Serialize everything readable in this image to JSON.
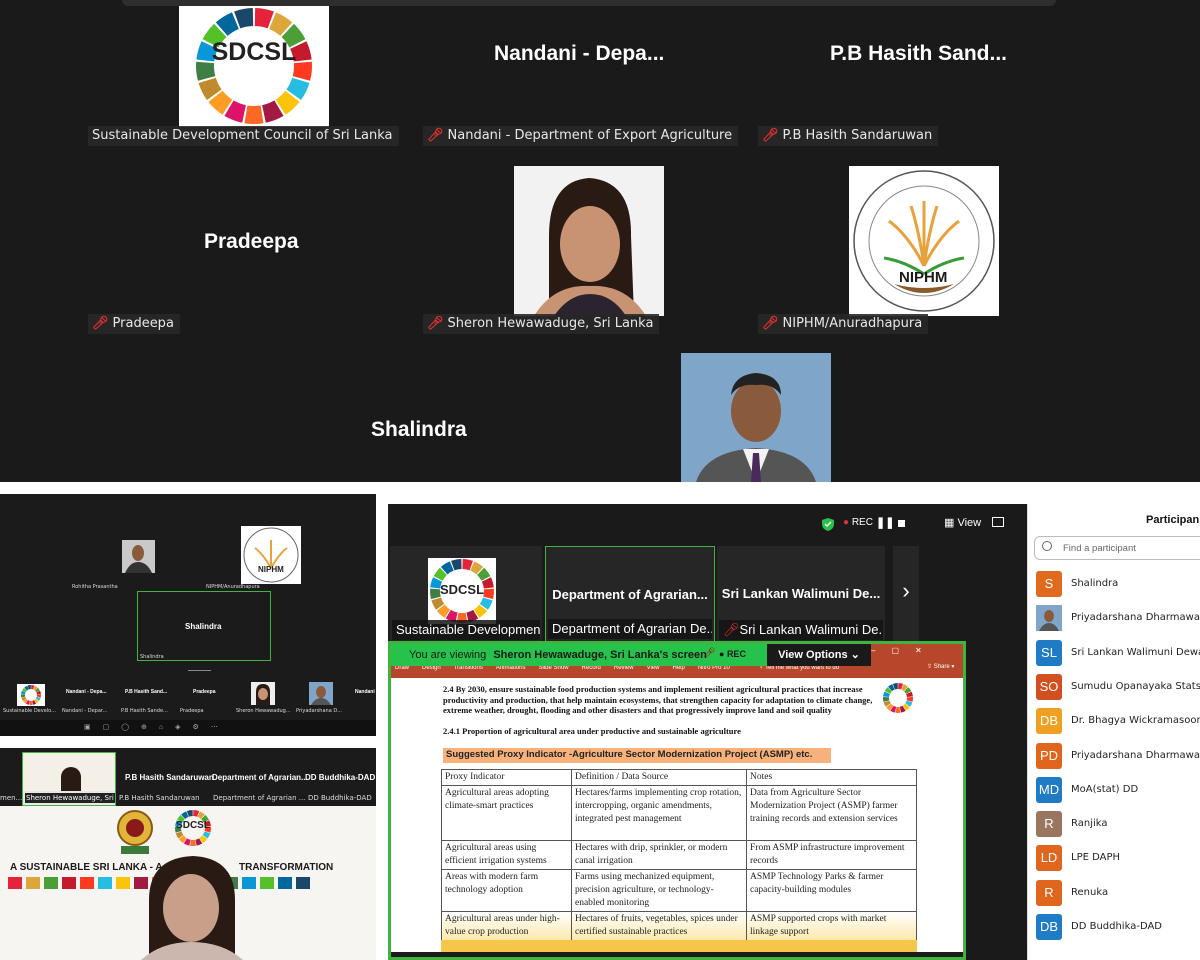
{
  "top_gallery": {
    "tiles": [
      {
        "label": "Sustainable Development Council of Sri Lanka",
        "logo_text": "SDCSL",
        "muted": false
      },
      {
        "big_name": "Nandani - Depa...",
        "label": "Nandani - Department of Export Agriculture",
        "muted": true
      },
      {
        "big_name": "P.B Hasith Sand...",
        "label": "P.B Hasith Sandaruwan",
        "muted": true
      },
      {
        "big_name": "Pradeepa",
        "label": "Pradeepa",
        "muted": true
      },
      {
        "label": "Sheron Hewawaduge, Sri Lanka",
        "muted": true
      },
      {
        "label": "NIPHM/Anuradhapura",
        "logo_text": "NIPHM",
        "muted": true
      },
      {
        "big_name": "Shalindra"
      }
    ]
  },
  "bottom_left_1": {
    "names": [
      "Rohitha Prasantha",
      "NIPHM/Anuradhapura",
      "Shalindra",
      "Shalindra"
    ],
    "strip": [
      "Sustainable Develo...",
      "Nandani - Depa...",
      "P.B Hasith Sand...",
      "Pradeepa",
      "Sheron Hewawadug...",
      "Priyadarshana D...",
      "Nandani"
    ],
    "strip_labels": [
      "Nandani - Depar...",
      "P.B Hasith Sande...",
      "Pradeepa",
      "Priyadarshana D..."
    ]
  },
  "bottom_left_2": {
    "tiles": [
      "Sheron Hewawaduge, Sri L...",
      "P.B Hasith Sandaruwan",
      "Department of Agrarian ...",
      "DD Buddhika-DAD"
    ],
    "big_names": [
      "P.B Hasith Sandaruwan",
      "Department of Agrarian...",
      "DD Buddhika-DAD"
    ],
    "left_cut": "men...",
    "banner_left": "A SUSTAINABLE SRI LANKA - A",
    "banner_right": "TRANSFORMATION",
    "logo_text": "SDCSL"
  },
  "zoom": {
    "rec": "REC",
    "view": "View",
    "tiles": [
      {
        "name": "",
        "caption": "Sustainable Developmen...",
        "logo_text": "SDCSL"
      },
      {
        "name": "Department of Agrarian...",
        "caption": "Department of Agrarian De..."
      },
      {
        "name": "Sri Lankan Walimuni De...",
        "caption": "Sri Lankan Walimuni De..."
      }
    ],
    "next": "›",
    "viewing_prefix": "You are viewing",
    "viewing_name": "Sheron Hewawaduge, Sri Lanka's screen",
    "view_options": "View Options",
    "ribbon_tabs": [
      "Draw",
      "Design",
      "Transitions",
      "Animations",
      "Slide Show",
      "Record",
      "Review",
      "View",
      "Help",
      "Nitro Pro 10"
    ],
    "tell_me": "Tell me what you want to do",
    "share": "Share",
    "doc_heading": "2.4 By 2030, ensure sustainable food production systems and implement resilient agricultural practices that increase productivity and production, that help maintain ecosystems, that strengthen capacity for adaptation to climate change, extreme weather, drought, flooding and other disasters and that progressively improve land and soil quality",
    "doc_sub": "2.4.1 Proportion of agricultural area under productive and sustainable agriculture",
    "proxy_title": "Suggested Proxy Indicator -Agriculture Sector Modernization Project (ASMP) etc.",
    "table_headers": [
      "Proxy Indicator",
      "Definition / Data Source",
      "Notes"
    ],
    "table_rows": [
      [
        "Agricultural areas adopting climate-smart practices",
        "Hectares/farms implementing crop rotation, intercropping, organic amendments, integrated pest management",
        "Data from Agriculture Sector Modernization Project (ASMP) farmer training records and extension services"
      ],
      [
        "Agricultural areas using efficient irrigation systems",
        "Hectares with drip, sprinkler, or modern canal irrigation",
        "From ASMP infrastructure improvement records"
      ],
      [
        "Areas with modern farm technology adoption",
        "Farms using mechanized equipment, precision agriculture, or technology-enabled monitoring",
        "ASMP Technology Parks & farmer capacity-building modules"
      ],
      [
        "Agricultural areas under high-value crop production",
        "Hectares of fruits, vegetables, spices under certified sustainable practices",
        "ASMP supported crops with market linkage support"
      ]
    ]
  },
  "participants": {
    "title": "Participan",
    "search_placeholder": "Find a participant",
    "list": [
      {
        "initials": "S",
        "name": "Shalindra",
        "color": "#e06b1f"
      },
      {
        "initials": "",
        "name": "Priyadarshana Dharmawarden",
        "color": "#5a7a9a",
        "photo": true
      },
      {
        "initials": "SL",
        "name": "Sri Lankan Walimuni Dewage",
        "color": "#1f7bc4"
      },
      {
        "initials": "SO",
        "name": "Sumudu Opanayaka Statstical",
        "color": "#d2501f"
      },
      {
        "initials": "DB",
        "name": "Dr. Bhagya Wickramasooriya",
        "color": "#f0a020"
      },
      {
        "initials": "PD",
        "name": "Priyadarshana Dharmawarden",
        "color": "#e0661d"
      },
      {
        "initials": "MD",
        "name": "MoA(stat) DD",
        "color": "#1f7bc4"
      },
      {
        "initials": "R",
        "name": "Ranjika",
        "color": "#9a7560"
      },
      {
        "initials": "LD",
        "name": "LPE DAPH",
        "color": "#e0661d"
      },
      {
        "initials": "R",
        "name": "Renuka",
        "color": "#e0661d"
      },
      {
        "initials": "DB",
        "name": "DD Buddhika-DAD",
        "color": "#1f7bc4"
      }
    ]
  }
}
